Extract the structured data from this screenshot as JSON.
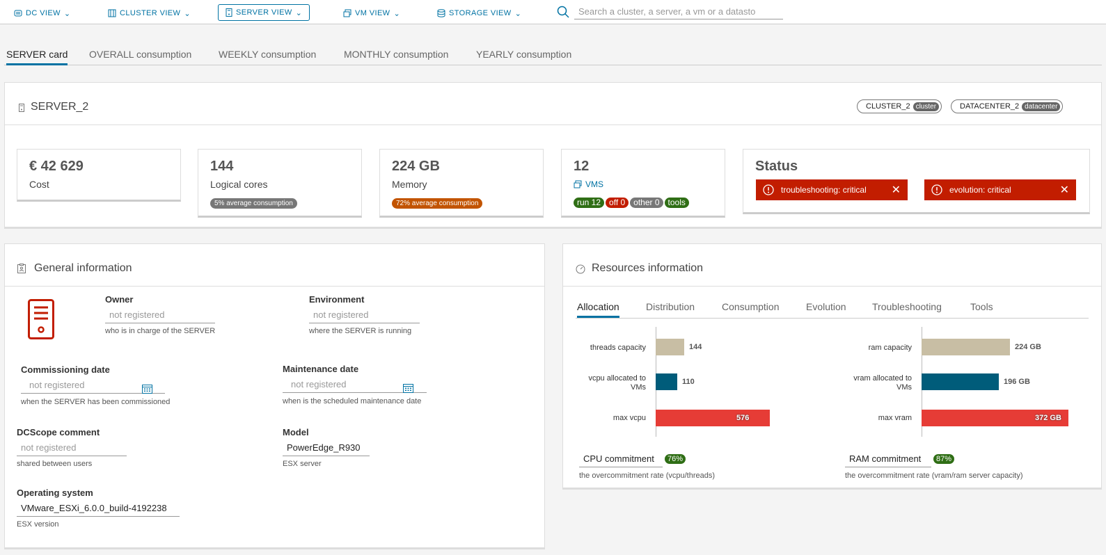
{
  "nav": {
    "items": [
      {
        "label": "DC VIEW",
        "icon": "datacenter-icon"
      },
      {
        "label": "CLUSTER VIEW",
        "icon": "cluster-icon"
      },
      {
        "label": "SERVER VIEW",
        "icon": "server-icon"
      },
      {
        "label": "VM VIEW",
        "icon": "vm-icon"
      },
      {
        "label": "STORAGE VIEW",
        "icon": "storage-icon"
      }
    ],
    "search_placeholder": "Search a cluster, a server, a vm or a datasto"
  },
  "subtabs": [
    "SERVER card",
    "OVERALL consumption",
    "WEEKLY consumption",
    "MONTHLY consumption",
    "YEARLY consumption"
  ],
  "server": {
    "name": "SERVER_2",
    "cluster": {
      "name": "CLUSTER_2",
      "badge": "cluster"
    },
    "datacenter": {
      "name": "DATACENTER_2",
      "badge": "datacenter"
    }
  },
  "stats": {
    "cost": {
      "value": "€ 42 629",
      "label": "Cost"
    },
    "cores": {
      "value": "144",
      "label": "Logical cores",
      "pill": "5% average consumption"
    },
    "memory": {
      "value": "224 GB",
      "label": "Memory",
      "pill": "72% average consumption"
    },
    "vms": {
      "value": "12",
      "label": "VMS",
      "tags": [
        "run 12",
        "off 0",
        "other 0",
        "tools"
      ]
    },
    "status": {
      "title": "Status",
      "alerts": [
        "troubleshooting: critical",
        "evolution: critical"
      ]
    }
  },
  "general": {
    "title": "General information",
    "owner": {
      "label": "Owner",
      "value": "not registered",
      "help": "who is in charge of the SERVER"
    },
    "environment": {
      "label": "Environment",
      "value": "not registered",
      "help": "where the SERVER is running"
    },
    "commissioning": {
      "label": "Commissioning date",
      "value": "not registered",
      "help": "when the SERVER has been commissioned"
    },
    "maintenance": {
      "label": "Maintenance date",
      "value": "not registered",
      "help": "when is the scheduled maintenance date"
    },
    "comment": {
      "label": "DCScope comment",
      "value": "not registered",
      "help": "shared between users"
    },
    "model": {
      "label": "Model",
      "value": "PowerEdge_R930",
      "help": "ESX server"
    },
    "os": {
      "label": "Operating system",
      "value": "VMware_ESXi_6.0.0_build-4192238",
      "help": "ESX version"
    }
  },
  "resources": {
    "title": "Resources information",
    "tabs": [
      "Allocation",
      "Distribution",
      "Consumption",
      "Evolution",
      "Troubleshooting",
      "Tools"
    ],
    "cpu": {
      "rows": [
        {
          "label": "threads capacity",
          "value": 144,
          "text": "144",
          "color": "#c8bea4"
        },
        {
          "label": "vcpu allocated to VMs",
          "value": 110,
          "text": "110",
          "color": "#005c7a"
        },
        {
          "label": "max vcpu",
          "value": 576,
          "text": "576",
          "color": "#e63c36"
        }
      ],
      "max": 576,
      "commit_label": "CPU commitment",
      "commit_value": "76%",
      "commit_help": "the overcommitment rate (vcpu/threads)"
    },
    "ram": {
      "rows": [
        {
          "label": "ram capacity",
          "value": 224,
          "text": "224 GB",
          "color": "#c8bea4"
        },
        {
          "label": "vram allocated to VMs",
          "value": 196,
          "text": "196 GB",
          "color": "#005c7a"
        },
        {
          "label": "max vram",
          "value": 372,
          "text": "372 GB",
          "color": "#e63c36"
        }
      ],
      "max": 372,
      "commit_label": "RAM commitment",
      "commit_value": "87%",
      "commit_help": "the overcommitment rate (vram/ram server capacity)"
    }
  },
  "colors": {
    "accent": "#0072a3",
    "critical": "#c21d00",
    "ok": "#2f6e15",
    "grey_pill": "#777777",
    "orange_pill": "#c25400"
  }
}
